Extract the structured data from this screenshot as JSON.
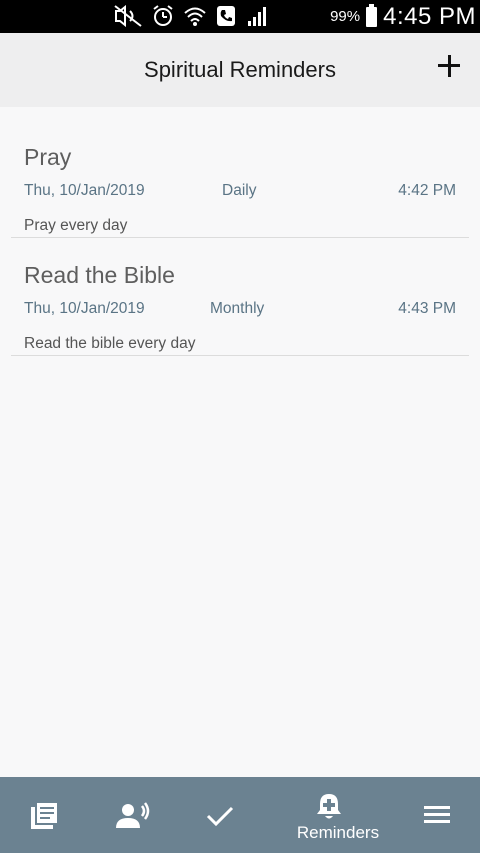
{
  "status_bar": {
    "battery": "99%",
    "time": "4:45 PM"
  },
  "header": {
    "title": "Spiritual Reminders",
    "add_icon": "plus-icon"
  },
  "reminders": [
    {
      "title": "Pray",
      "date": "Thu, 10/Jan/2019",
      "frequency": "Daily",
      "time": "4:42 PM",
      "note": "Pray every day"
    },
    {
      "title": "Read the Bible",
      "date": "Thu, 10/Jan/2019",
      "frequency": "Monthly",
      "time": "4:43 PM",
      "note": "Read the bible every day"
    }
  ],
  "bottom_nav": {
    "items": [
      {
        "icon": "book-list-icon"
      },
      {
        "icon": "speaking-person-icon"
      },
      {
        "icon": "checkmark-icon"
      },
      {
        "icon": "bell-plus-icon",
        "label": "Reminders",
        "active": true
      },
      {
        "icon": "menu-icon"
      }
    ]
  },
  "colors": {
    "header_bg": "#eeeeef",
    "nav_bg": "#6b8291",
    "accent_text": "#5a7485"
  }
}
